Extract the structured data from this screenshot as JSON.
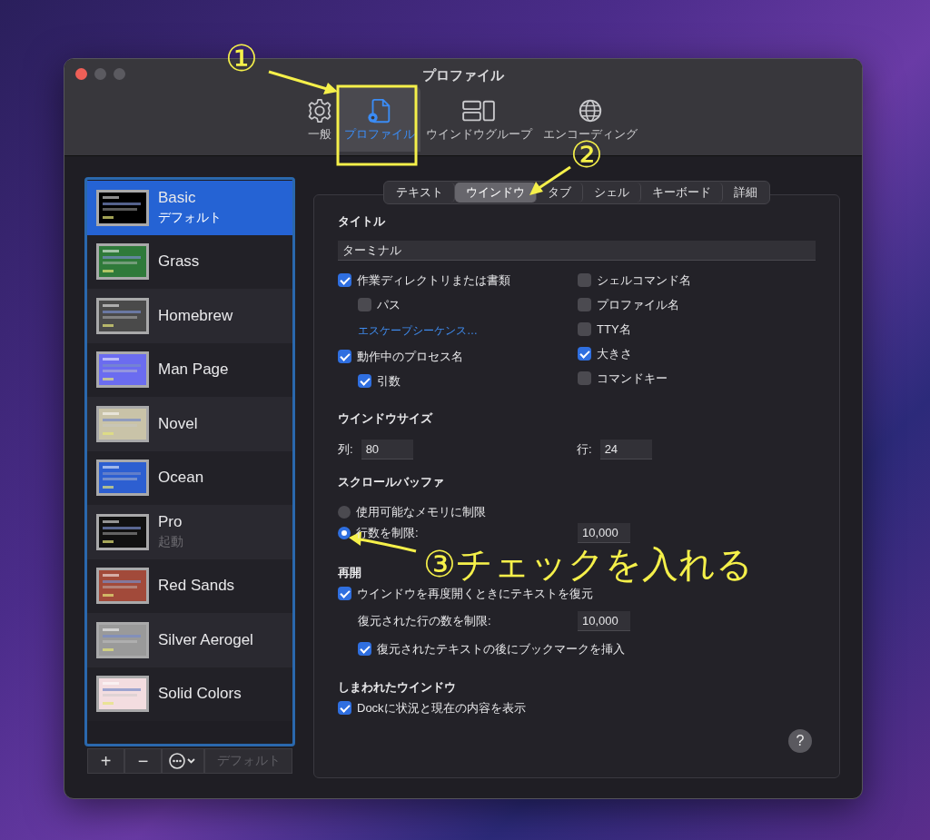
{
  "window": {
    "title": "プロファイル"
  },
  "toolbar": [
    {
      "kind": "gear",
      "label": "一般",
      "selected": false
    },
    {
      "kind": "profile",
      "label": "プロファイル",
      "selected": true
    },
    {
      "kind": "windows",
      "label": "ウインドウグループ",
      "selected": false
    },
    {
      "kind": "globe",
      "label": "エンコーディング",
      "selected": false
    }
  ],
  "profiles": [
    {
      "name": "Basic",
      "subtitle": "デフォルト",
      "color": "#000000",
      "selected": true
    },
    {
      "name": "Grass",
      "color": "#2f7a3a",
      "selected": false
    },
    {
      "name": "Homebrew",
      "color": "#4a4a4a",
      "selected": false
    },
    {
      "name": "Man Page",
      "color": "#6b6cf0",
      "selected": false
    },
    {
      "name": "Novel",
      "color": "#c9c3a8",
      "selected": false
    },
    {
      "name": "Ocean",
      "color": "#2d5fd1",
      "selected": false
    },
    {
      "name": "Pro",
      "subtitle": "起動",
      "color": "#111111",
      "selected": false
    },
    {
      "name": "Red Sands",
      "color": "#a24a3a",
      "selected": false
    },
    {
      "name": "Silver Aerogel",
      "color": "#9a9a9a",
      "selected": false
    },
    {
      "name": "Solid Colors",
      "color": "#f3dde0",
      "selected": false
    }
  ],
  "add_button": "+",
  "remove_button": "−",
  "default_button": {
    "label": "デフォルト",
    "disabled": true
  },
  "tabs": [
    {
      "label": "テキスト",
      "selected": false
    },
    {
      "label": "ウインドウ",
      "selected": true
    },
    {
      "label": "タブ",
      "selected": false
    },
    {
      "label": "シェル",
      "selected": false
    },
    {
      "label": "キーボード",
      "selected": false
    },
    {
      "label": "詳細",
      "selected": false
    }
  ],
  "title_section": {
    "heading": "タイトル",
    "title_value": "ターミナル",
    "left_options": [
      {
        "kind": "checkbox",
        "label": "作業ディレクトリまたは書類",
        "checked": true,
        "children": [
          {
            "kind": "checkbox",
            "label": "パス",
            "checked": false
          },
          {
            "kind": "link",
            "label": "エスケープシーケンス…"
          }
        ]
      },
      {
        "kind": "checkbox",
        "label": "動作中のプロセス名",
        "checked": true,
        "children": [
          {
            "kind": "checkbox",
            "label": "引数",
            "checked": true
          }
        ]
      }
    ],
    "right_options": [
      {
        "label": "シェルコマンド名",
        "checked": false
      },
      {
        "label": "プロファイル名",
        "checked": false
      },
      {
        "label": "TTY名",
        "checked": false
      },
      {
        "label": "大きさ",
        "checked": true
      },
      {
        "label": "コマンドキー",
        "checked": false
      }
    ]
  },
  "window_size": {
    "heading": "ウインドウサイズ",
    "columns_label": "列:",
    "columns": "80",
    "rows_label": "行:",
    "rows": "24"
  },
  "scrollback": {
    "heading": "スクロールバッファ",
    "options": [
      {
        "label": "使用可能なメモリに制限",
        "selected": false
      },
      {
        "label": "行数を制限:",
        "selected": true,
        "value": "10,000"
      }
    ]
  },
  "restore": {
    "heading": "再開",
    "restore_text": {
      "label": "ウインドウを再度開くときにテキストを復元",
      "checked": true
    },
    "limit_label": "復元された行の数を制限:",
    "limit_value": "10,000",
    "bookmark": {
      "label": "復元されたテキストの後にブックマークを挿入",
      "checked": true
    }
  },
  "minimized": {
    "heading": "しまわれたウインドウ",
    "dock_option": {
      "label": "Dockに状況と現在の内容を表示",
      "checked": true
    }
  },
  "help_button": "?",
  "annotations": [
    {
      "label": "①"
    },
    {
      "label": "②"
    },
    {
      "label": "③チェックを入れる"
    }
  ]
}
